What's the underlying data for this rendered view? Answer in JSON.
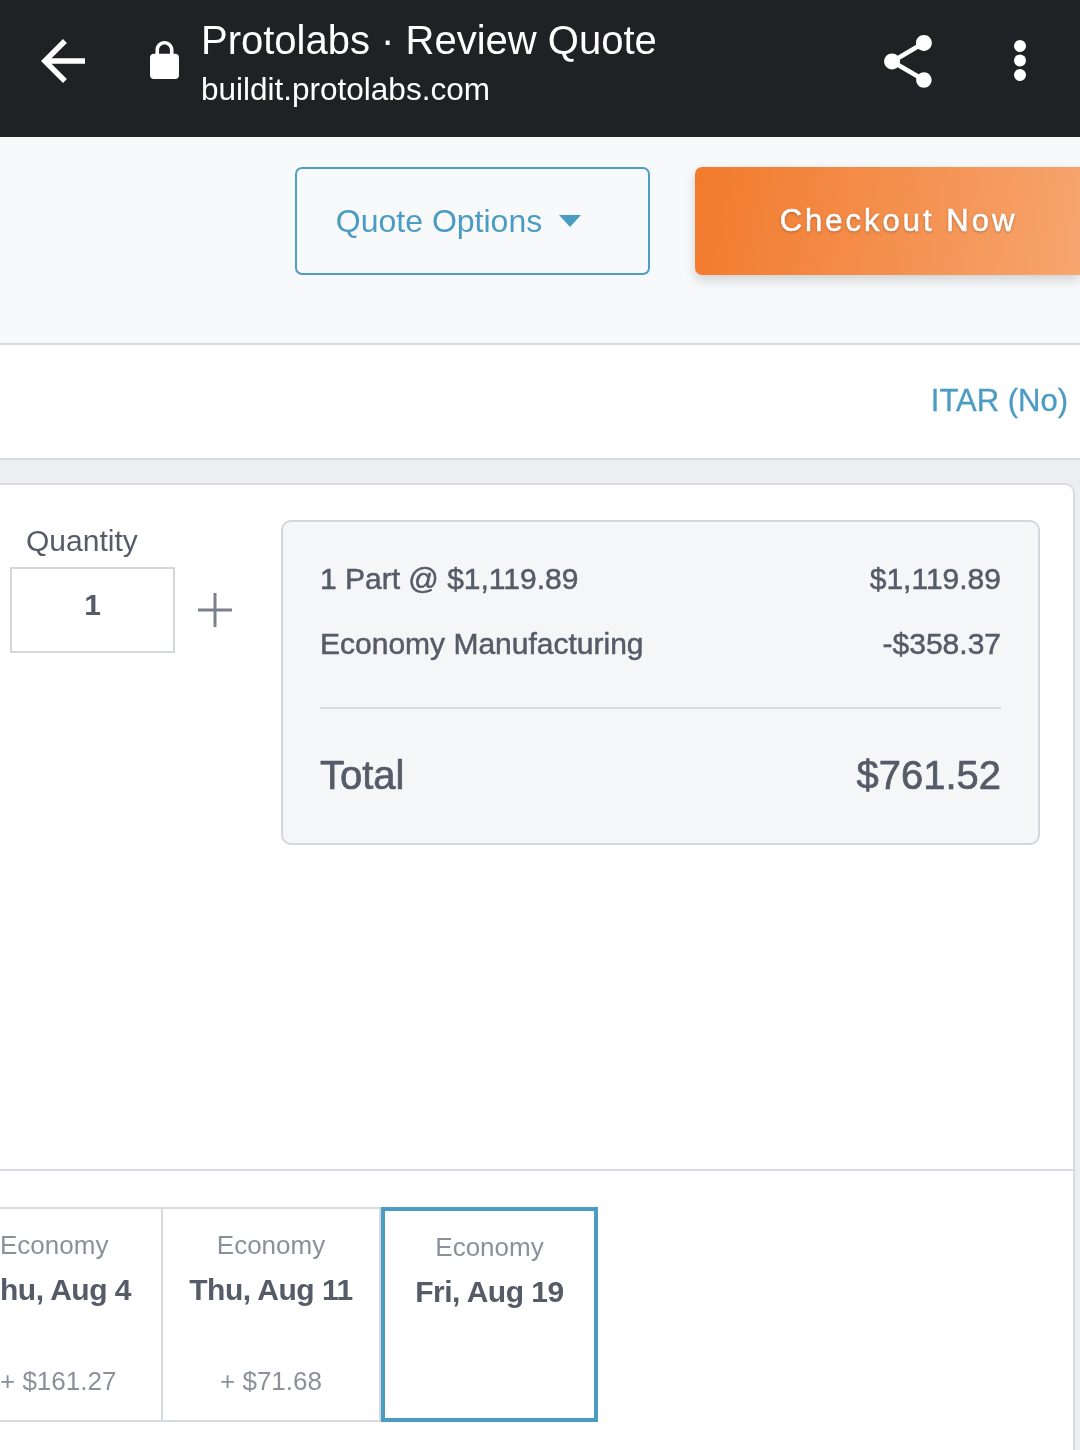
{
  "browser_bar": {
    "title": "Protolabs · Review Quote",
    "url": "buildit.protolabs.com"
  },
  "actions": {
    "quote_options": "Quote Options",
    "checkout": "Checkout Now"
  },
  "itar_link": "ITAR (No)",
  "quantity": {
    "label": "Quantity",
    "value": "1"
  },
  "price_summary": {
    "lines": [
      {
        "label": "1 Part @ $1,119.89",
        "amount": "$1,119.89"
      },
      {
        "label": "Economy Manufacturing",
        "amount": "-$358.37"
      }
    ],
    "total": {
      "label": "Total",
      "amount": "$761.52"
    }
  },
  "delivery_options": [
    {
      "tier": "Economy",
      "date": "hu, Aug 4",
      "price": "+ $161.27",
      "selected": false
    },
    {
      "tier": "Economy",
      "date": "Thu, Aug 11",
      "price": "+ $71.68",
      "selected": false
    },
    {
      "tier": "Economy",
      "date": "Fri, Aug 19",
      "selected": true
    }
  ]
}
